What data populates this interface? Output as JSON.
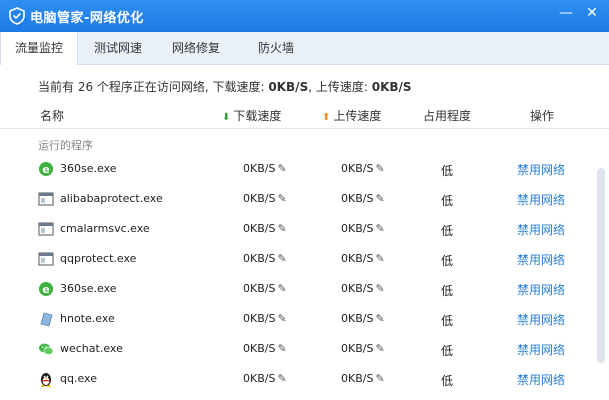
{
  "window": {
    "title": "电脑管家-网络优化",
    "min": "—",
    "close": "✕"
  },
  "tabs": [
    "流量监控",
    "测试网速",
    "网络修复",
    "防火墙"
  ],
  "summary": {
    "prefix": "当前有 26 个程序正在访问网络, 下载速度: ",
    "download": "0KB/S",
    "middle": ", 上传速度: ",
    "upload": "0KB/S"
  },
  "header": {
    "name": "名称",
    "download": "下载速度",
    "upload": "上传速度",
    "occupancy": "占用程度",
    "action": "操作"
  },
  "group": {
    "label": "运行的程序"
  },
  "rows": [
    {
      "icon": "ie-icon",
      "name": "360se.exe",
      "download": "0KB/S",
      "upload": "0KB/S",
      "occupancy": "低",
      "action": "禁用网络"
    },
    {
      "icon": "app-window-icon",
      "name": "alibabaprotect.exe",
      "download": "0KB/S",
      "upload": "0KB/S",
      "occupancy": "低",
      "action": "禁用网络"
    },
    {
      "icon": "app-window-icon",
      "name": "cmalarmsvc.exe",
      "download": "0KB/S",
      "upload": "0KB/S",
      "occupancy": "低",
      "action": "禁用网络"
    },
    {
      "icon": "app-window-icon",
      "name": "qqprotect.exe",
      "download": "0KB/S",
      "upload": "0KB/S",
      "occupancy": "低",
      "action": "禁用网络"
    },
    {
      "icon": "ie-icon",
      "name": "360se.exe",
      "download": "0KB/S",
      "upload": "0KB/S",
      "occupancy": "低",
      "action": "禁用网络"
    },
    {
      "icon": "note-icon",
      "name": "hnote.exe",
      "download": "0KB/S",
      "upload": "0KB/S",
      "occupancy": "低",
      "action": "禁用网络"
    },
    {
      "icon": "wechat-icon",
      "name": "wechat.exe",
      "download": "0KB/S",
      "upload": "0KB/S",
      "occupancy": "低",
      "action": "禁用网络"
    },
    {
      "icon": "qq-penguin-icon",
      "name": "qq.exe",
      "download": "0KB/S",
      "upload": "0KB/S",
      "occupancy": "低",
      "action": "禁用网络"
    }
  ],
  "colors": {
    "titlebar": "#1c79e6",
    "link": "#2a7fd4",
    "download_arrow": "#2e9f2e",
    "upload_arrow": "#f08a1c"
  }
}
